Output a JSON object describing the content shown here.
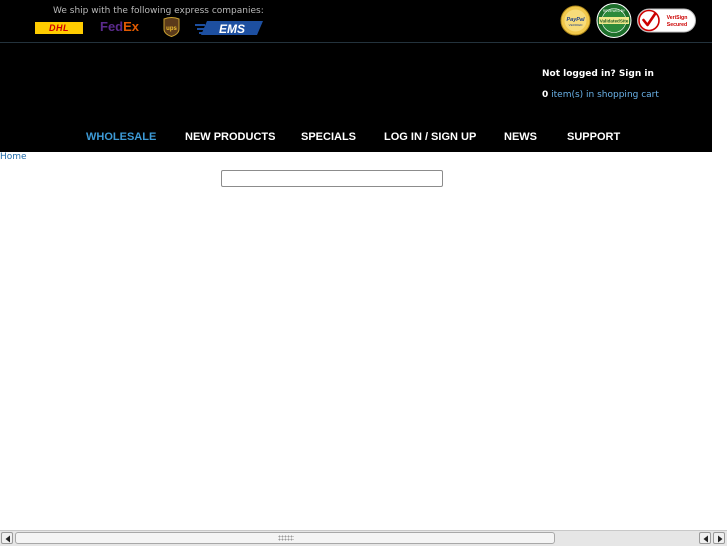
{
  "header": {
    "ship_text": "We ship with the following express companies:",
    "carriers": {
      "dhl": "DHL",
      "fedex_fed": "Fed",
      "fedex_ex": "Ex",
      "ups": "ups",
      "ems": "EMS"
    },
    "badges": {
      "paypal": "PayPal",
      "validated": "ValidatedSite",
      "verisign_line1": "VeriSign",
      "verisign_line2": "Secured"
    }
  },
  "user": {
    "status": "Not logged in? Sign in",
    "cart_count": "0",
    "cart_text": "item(s) in shopping cart"
  },
  "nav": {
    "items": [
      {
        "label": "WHOLESALE"
      },
      {
        "label": "NEW PRODUCTS"
      },
      {
        "label": "SPECIALS"
      },
      {
        "label": "LOG IN / SIGN UP"
      },
      {
        "label": "NEWS"
      },
      {
        "label": "SUPPORT"
      }
    ]
  },
  "breadcrumb": "Home",
  "search": {
    "value": "",
    "placeholder": ""
  },
  "colors": {
    "header_bg": "#000000",
    "nav_active": "#3d9ad6",
    "link": "#1f6aa8",
    "cart_link": "#6ab2e8"
  }
}
